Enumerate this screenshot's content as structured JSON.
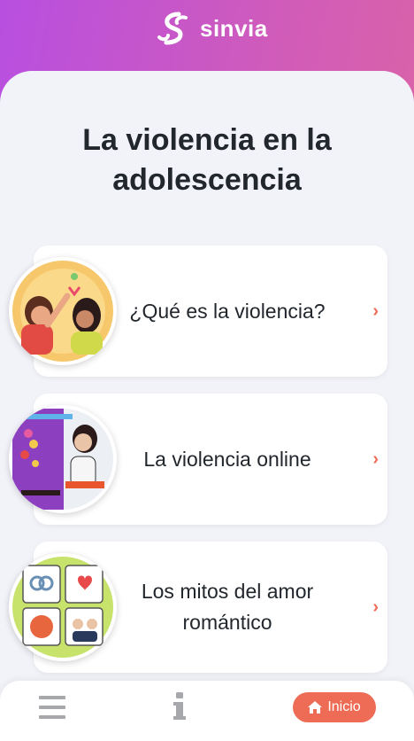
{
  "app": {
    "logo_text": "sinvia"
  },
  "page": {
    "title": "La violencia en la adolescencia"
  },
  "cards": [
    {
      "label": "¿Qué es la violencia?",
      "icon": "chevron-right-icon"
    },
    {
      "label": "La violencia online",
      "icon": "chevron-right-icon"
    },
    {
      "label": "Los mitos del amor romántico",
      "icon": "chevron-right-icon"
    }
  ],
  "bottom_nav": {
    "menu_icon": "menu-icon",
    "info_icon": "info-icon",
    "home_label": "Inicio",
    "home_icon": "home-icon"
  },
  "colors": {
    "header_gradient_start": "#b84fe0",
    "header_gradient_end": "#e0679e",
    "accent": "#ee6b55",
    "background": "#f2f3f9",
    "text": "#22272d"
  }
}
